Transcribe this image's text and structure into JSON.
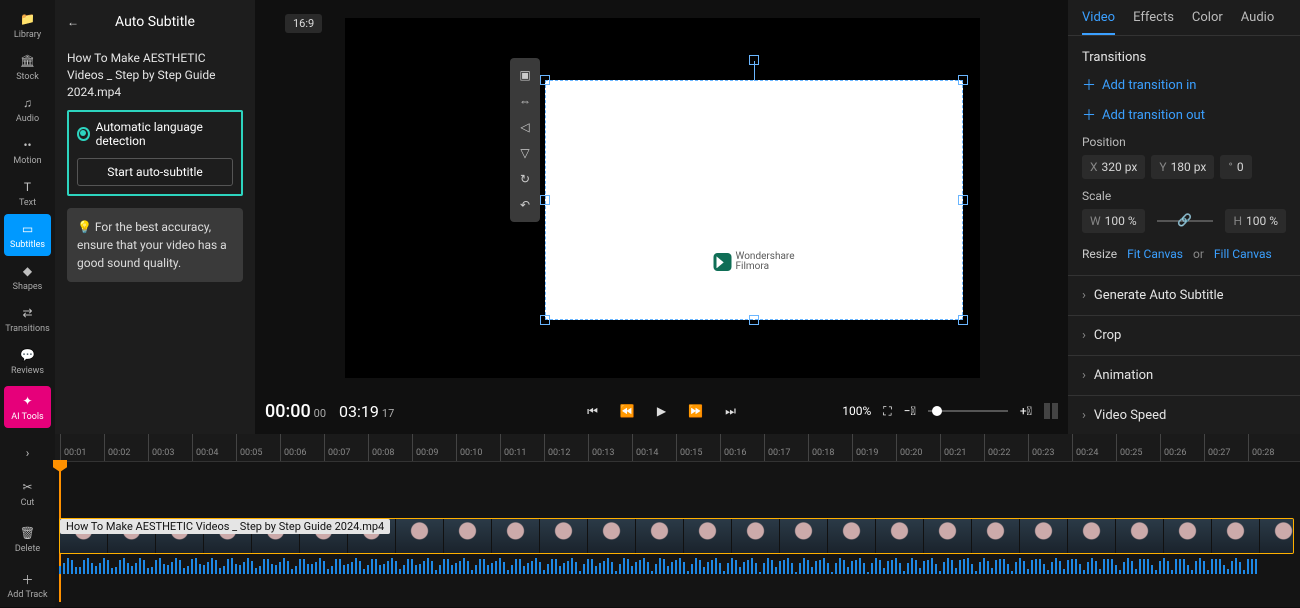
{
  "rail": {
    "library": "Library",
    "stock": "Stock",
    "audio": "Audio",
    "motion": "Motion",
    "text": "Text",
    "subtitles": "Subtitles",
    "shapes": "Shapes",
    "transitions": "Transitions",
    "reviews": "Reviews",
    "aitools": "AI Tools",
    "cut": "Cut",
    "delete": "Delete",
    "addtrack": "Add Track"
  },
  "subtitle_panel": {
    "title": "Auto Subtitle",
    "filename": "How To Make AESTHETIC Videos _ Step by Step Guide 2024.mp4",
    "auto_detect_label": "Automatic language detection",
    "start_btn": "Start auto-subtitle",
    "tip": "💡 For the best accuracy, ensure that your video has a good sound quality."
  },
  "stage": {
    "aspect": "16:9",
    "watermark_brand": "Wondershare",
    "watermark_product": "Filmora"
  },
  "player": {
    "current": "00:00",
    "current_frames": "00",
    "duration": "03:19",
    "duration_frames": "17",
    "zoom": "100%"
  },
  "inspector": {
    "tabs": {
      "video": "Video",
      "effects": "Effects",
      "color": "Color",
      "audio": "Audio"
    },
    "transitions": {
      "heading": "Transitions",
      "add_in": "Add transition in",
      "add_out": "Add transition out"
    },
    "position": {
      "label": "Position",
      "x_label": "X",
      "x_val": "320 px",
      "y_label": "Y",
      "y_val": "180 px",
      "rot_sym": "°",
      "rot_val": "0"
    },
    "scale": {
      "label": "Scale",
      "w_label": "W",
      "w_val": "100 %",
      "h_label": "H",
      "h_val": "100 %"
    },
    "resize": {
      "label": "Resize",
      "fit": "Fit Canvas",
      "or": "or",
      "fill": "Fill Canvas"
    },
    "accordions": {
      "auto_sub": "Generate Auto Subtitle",
      "crop": "Crop",
      "animation": "Animation",
      "speed": "Video Speed"
    }
  },
  "timeline": {
    "labels": [
      "00:01",
      "00:02",
      "00:03",
      "00:04",
      "00:05",
      "00:06",
      "00:07",
      "00:08",
      "00:09",
      "00:10",
      "00:11",
      "00:12",
      "00:13",
      "00:14",
      "00:15",
      "00:16",
      "00:17",
      "00:18",
      "00:19",
      "00:20",
      "00:21",
      "00:22",
      "00:23",
      "00:24",
      "00:25",
      "00:26",
      "00:27",
      "00:28"
    ],
    "clip_label": "How To Make AESTHETIC Videos _ Step by Step Guide 2024.mp4"
  }
}
